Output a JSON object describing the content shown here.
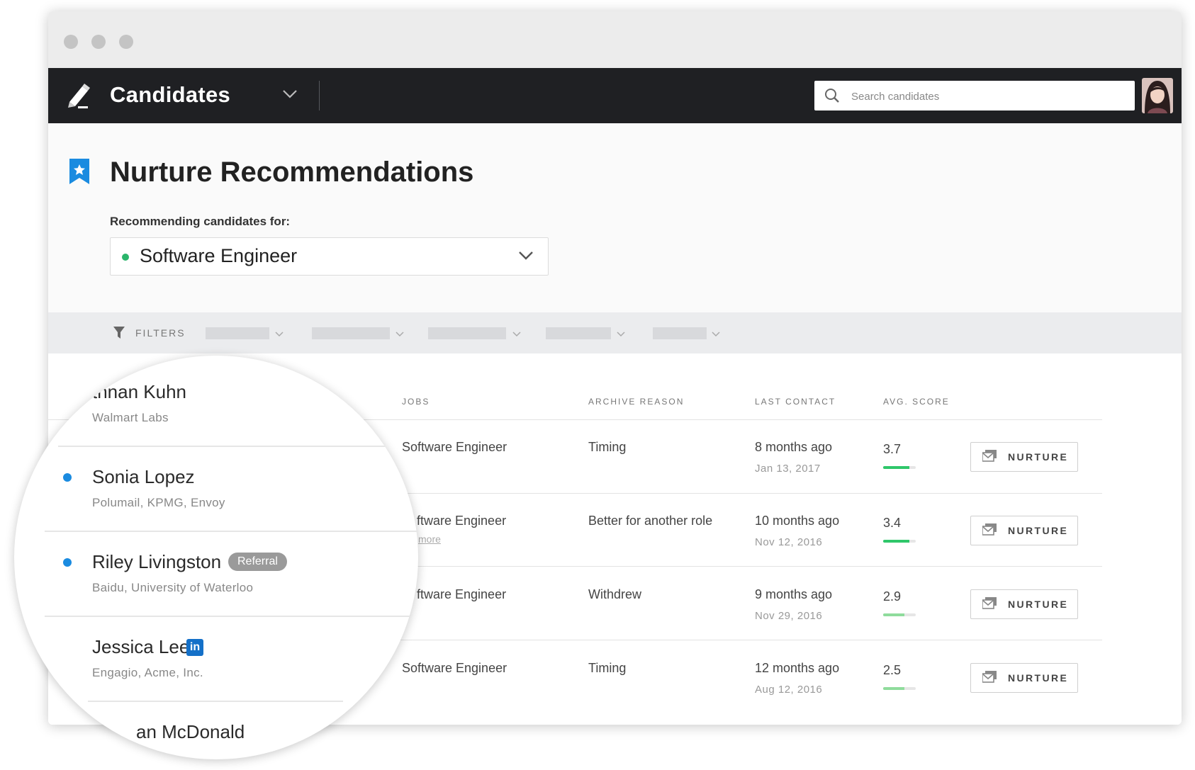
{
  "header": {
    "app_title": "Candidates",
    "search_placeholder": "Search candidates"
  },
  "page": {
    "title": "Nurture Recommendations",
    "recommending_label": "Recommending candidates for:",
    "selected_job": "Software Engineer"
  },
  "filters": {
    "label": "FILTERS"
  },
  "table": {
    "columns": [
      "JOBS",
      "ARCHIVE REASON",
      "LAST CONTACT",
      "AVG. SCORE"
    ],
    "rows": [
      {
        "job": "Software Engineer",
        "more": "",
        "archive_reason": "Timing",
        "last_contact": "8 months ago",
        "contact_date": "Jan 13, 2017",
        "score": "3.7",
        "score_fraction": 0.8
      },
      {
        "job": "ftware Engineer",
        "more": "more",
        "archive_reason": "Better for another role",
        "last_contact": "10 months ago",
        "contact_date": "Nov 12, 2016",
        "score": "3.4",
        "score_fraction": 0.8
      },
      {
        "job": "ftware Engineer",
        "more": "",
        "archive_reason": "Withdrew",
        "last_contact": "9 months ago",
        "contact_date": "Nov 29, 2016",
        "score": "2.9",
        "score_fraction": 0.65
      },
      {
        "job": "Software Engineer",
        "more": "",
        "archive_reason": "Timing",
        "last_contact": "12 months ago",
        "contact_date": "Aug 12, 2016",
        "score": "2.5",
        "score_fraction": 0.65
      }
    ],
    "nurture_label": "NURTURE"
  },
  "magnifier": {
    "candidates": [
      {
        "name": "thnan Kuhn",
        "company": "Walmart Labs",
        "new": false,
        "badge": ""
      },
      {
        "name": "Sonia Lopez",
        "company": "Polumail, KPMG, Envoy",
        "new": true,
        "badge": ""
      },
      {
        "name": "Riley Livingston",
        "company": "Baidu, University of Waterloo",
        "new": true,
        "badge": "Referral"
      },
      {
        "name": "Jessica Lee",
        "company": "Engagio, Acme, Inc.",
        "new": false,
        "badge": "in"
      },
      {
        "name": "an McDonald",
        "company": "",
        "new": false,
        "badge": ""
      }
    ]
  },
  "colors": {
    "navbar": "#1f2023",
    "accent_blue": "#1a8be0",
    "status_green": "#2ab56b",
    "score_green": "#2fc76a",
    "linkedin_blue": "#1470c8"
  },
  "icons": [
    "pen-logo-icon",
    "chevron-down-icon",
    "search-icon",
    "bookmark-star-icon",
    "funnel-icon",
    "envelope-icon",
    "linkedin-icon"
  ]
}
